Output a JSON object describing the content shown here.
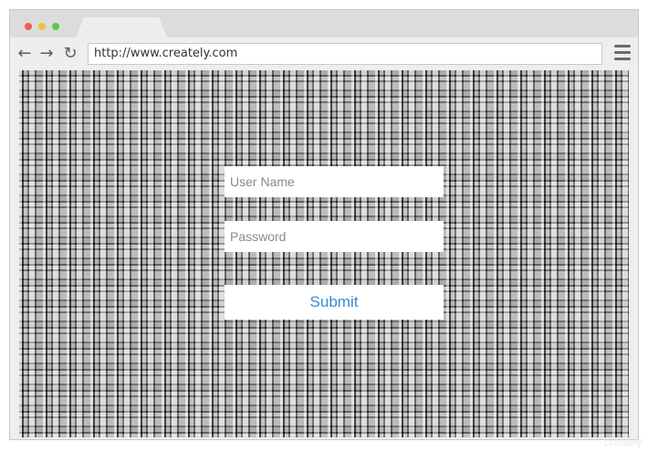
{
  "browser": {
    "url": "http://www.creately.com",
    "icons": [
      "back-arrow-icon",
      "forward-arrow-icon",
      "reload-icon",
      "hamburger-menu-icon"
    ]
  },
  "login_form": {
    "username_placeholder": "User Name",
    "password_placeholder": "Password",
    "submit_label": "Submit"
  },
  "watermark": "creately",
  "colors": {
    "submit_text": "#3a8bd6",
    "traffic_red": "#ee5b57",
    "traffic_yellow": "#f4bd3b",
    "traffic_green": "#5fc350"
  }
}
